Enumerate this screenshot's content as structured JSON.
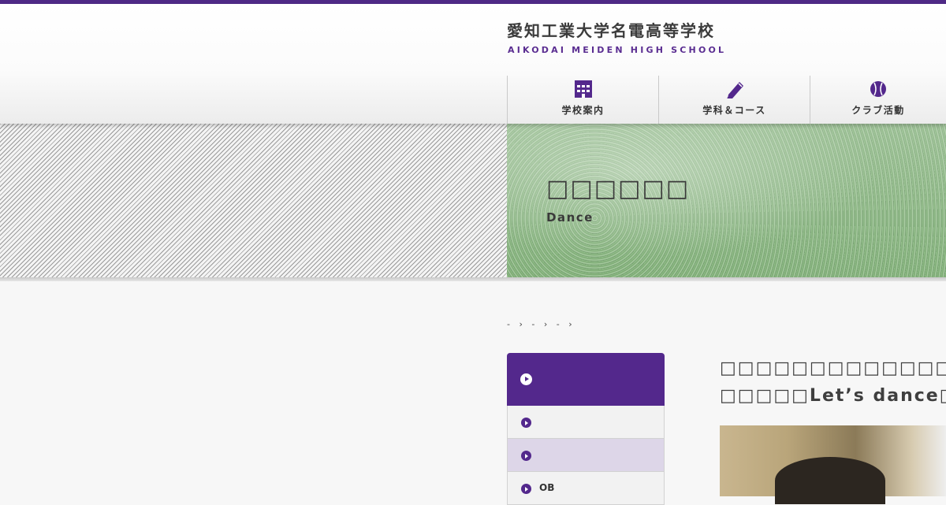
{
  "header": {
    "school_name_jp": "愛知工業大学名電高等学校",
    "school_name_en": "AIKODAI MEIDEN HIGH SCHOOL",
    "accent_color": "#4f2a86"
  },
  "nav": [
    {
      "label": "学校案内",
      "icon": "school-building-icon"
    },
    {
      "label": "学科＆コース",
      "icon": "pencil-icon"
    },
    {
      "label": "クラブ活動",
      "icon": "baseball-icon"
    }
  ],
  "hero": {
    "title": "□□□□□□",
    "subtitle": "Dance"
  },
  "breadcrumb": [
    "-",
    "›",
    "-",
    "›",
    "-",
    "›"
  ],
  "sidebar": {
    "items": [
      {
        "label": "",
        "active": false
      },
      {
        "label": "",
        "active": true
      },
      {
        "label": "OB",
        "active": false
      }
    ]
  },
  "article": {
    "title_line1": "□□□□□□□□□□□□□□□□□□□",
    "title_line2": "□□□□□Let’s dance□"
  }
}
